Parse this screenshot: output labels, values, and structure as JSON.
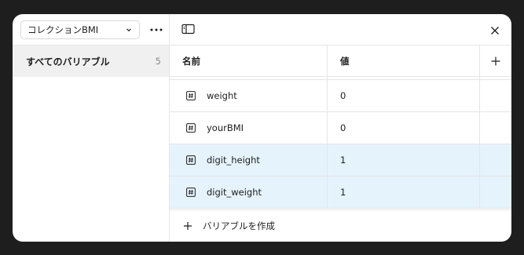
{
  "sidebar": {
    "collection_select": {
      "label": "コレクションBMI",
      "icon": "chevron-down-icon"
    },
    "more_icon": "more-horizontal-icon",
    "items": [
      {
        "label": "すべてのバリアブル",
        "count": "5",
        "selected": true
      }
    ]
  },
  "toolbar": {
    "toggle_icon": "sidebar-toggle-icon",
    "close_icon": "close-icon"
  },
  "table": {
    "headers": {
      "name": "名前",
      "value": "値",
      "add_icon": "plus-icon"
    },
    "rows": [
      {
        "icon": "number-variable-icon",
        "name": "weight",
        "value": "0",
        "selected": false
      },
      {
        "icon": "number-variable-icon",
        "name": "yourBMI",
        "value": "0",
        "selected": false
      },
      {
        "icon": "number-variable-icon",
        "name": "digit_height",
        "value": "1",
        "selected": true
      },
      {
        "icon": "number-variable-icon",
        "name": "digit_weight",
        "value": "1",
        "selected": true
      }
    ]
  },
  "footer": {
    "create_label": "バリアブルを作成",
    "icon": "plus-icon"
  },
  "colors": {
    "selected_row": "#e5f3fd",
    "sidebar_selected": "#f0f0f0",
    "border": "#e6e6e6"
  }
}
